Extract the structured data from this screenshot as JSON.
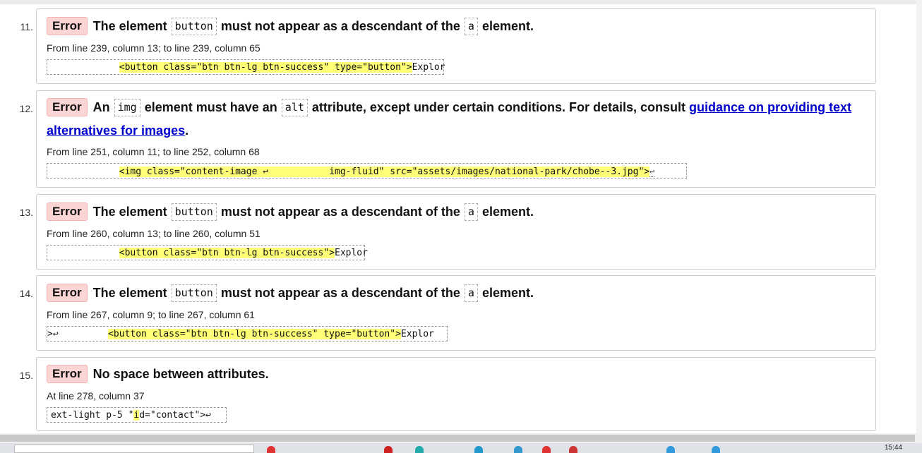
{
  "errors": [
    {
      "num": "11.",
      "badge": "Error",
      "m1": "The element",
      "code1": "button",
      "m2": "must not appear as a descendant of the",
      "code2": "a",
      "m3": "element.",
      "location": "From line 239, column 13; to line 239, column 65",
      "extract_pre": "             ",
      "extract_hl": "<button class=\"btn btn-lg btn-success\" type=\"button\">",
      "extract_post": "Explor"
    },
    {
      "num": "12.",
      "badge": "Error",
      "m1": "An",
      "code1": "img",
      "m2": "element must have an",
      "code2": "alt",
      "m3": "attribute, except under certain conditions. For details, consult",
      "link": "guidance on providing text alternatives for images",
      "m4": ".",
      "location": "From line 251, column 11; to line 252, column 68",
      "extract_pre": "             ",
      "extract_hl": "<img class=\"content-image ↩           img-fluid\" src=\"assets/images/national-park/chobe--3.jpg\">",
      "extract_post": "↩"
    },
    {
      "num": "13.",
      "badge": "Error",
      "m1": "The element",
      "code1": "button",
      "m2": "must not appear as a descendant of the",
      "code2": "a",
      "m3": "element.",
      "location": "From line 260, column 13; to line 260, column 51",
      "extract_pre": "             ",
      "extract_hl": "<button class=\"btn btn-lg btn-success\">",
      "extract_post": "Explor"
    },
    {
      "num": "14.",
      "badge": "Error",
      "m1": "The element",
      "code1": "button",
      "m2": "must not appear as a descendant of the",
      "code2": "a",
      "m3": "element.",
      "location": "From line 267, column 9; to line 267, column 61",
      "extract_pre": ">↩         ",
      "extract_hl": "<button class=\"btn btn-lg btn-success\" type=\"button\">",
      "extract_post": "Explor"
    },
    {
      "num": "15.",
      "badge": "Error",
      "m1": "No space between attributes.",
      "location": "At line 278, column 37",
      "extract_pre": "ext-light p-5 \"",
      "extract_hl": "i",
      "extract_post": "d=\"contact\">↩"
    }
  ],
  "taskbar": {
    "clock": "15:44"
  },
  "colors": {
    "badge_bg": "#fbd4d4",
    "highlight": "#ffff77",
    "link": "#0000cc"
  }
}
